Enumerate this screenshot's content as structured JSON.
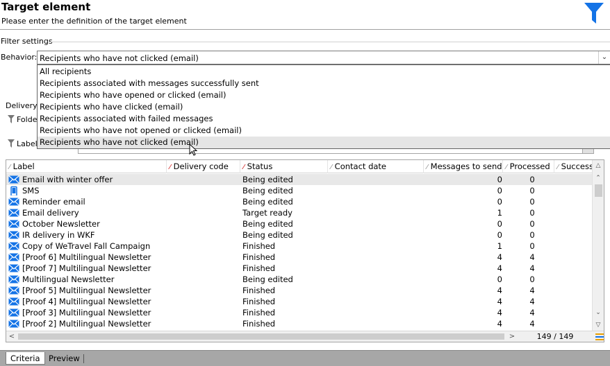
{
  "header": {
    "title": "Target element",
    "subtitle": "Please enter the definition of the target element"
  },
  "filter_settings": {
    "legend": "Filter settings",
    "behavior_label": "Behavior:",
    "behavior_value": "Recipients who have not clicked (email)",
    "options": [
      "All recipients",
      "Recipients associated with messages successfully sent",
      "Recipients who have opened or clicked (email)",
      "Recipients who have clicked (email)",
      "Recipients associated with failed messages",
      "Recipients who have not opened or clicked (email)",
      "Recipients who have not clicked (email)"
    ],
    "hovered_option": "Recipients who have not clicked (email)"
  },
  "delivery": {
    "legend": "Delivery",
    "folder_label": "Folde",
    "label_label": "Label"
  },
  "grid": {
    "columns": [
      "Label",
      "Delivery code",
      "Status",
      "Contact date",
      "Messages to send",
      "Processed",
      "Success"
    ],
    "rows": [
      {
        "label": "Email with winter offer",
        "type": "email",
        "status": "Being edited",
        "messages": "0",
        "processed": "0"
      },
      {
        "label": "SMS",
        "type": "sms",
        "status": "Being edited",
        "messages": "0",
        "processed": "0"
      },
      {
        "label": "Reminder email",
        "type": "email",
        "status": "Being edited",
        "messages": "0",
        "processed": "0"
      },
      {
        "label": "Email delivery",
        "type": "email",
        "status": "Target ready",
        "messages": "1",
        "processed": "0"
      },
      {
        "label": "October Newsletter",
        "type": "email",
        "status": "Being edited",
        "messages": "0",
        "processed": "0"
      },
      {
        "label": "IR delivery in WKF",
        "type": "email",
        "status": "Being edited",
        "messages": "0",
        "processed": "0"
      },
      {
        "label": "Copy of WeTravel Fall Campaign",
        "type": "email",
        "status": "Finished",
        "messages": "1",
        "processed": "0"
      },
      {
        "label": "[Proof 6] Multilingual Newsletter",
        "type": "email",
        "status": "Finished",
        "messages": "4",
        "processed": "4"
      },
      {
        "label": "[Proof 7] Multilingual Newsletter",
        "type": "email",
        "status": "Finished",
        "messages": "4",
        "processed": "4"
      },
      {
        "label": "Multilingual Newsletter",
        "type": "email",
        "status": "Being edited",
        "messages": "0",
        "processed": "0"
      },
      {
        "label": "[Proof 5] Multilingual Newsletter",
        "type": "email",
        "status": "Finished",
        "messages": "4",
        "processed": "4"
      },
      {
        "label": "[Proof 4] Multilingual Newsletter",
        "type": "email",
        "status": "Finished",
        "messages": "4",
        "processed": "4"
      },
      {
        "label": "[Proof 3] Multilingual Newsletter",
        "type": "email",
        "status": "Finished",
        "messages": "4",
        "processed": "4"
      },
      {
        "label": "[Proof 2] Multilingual Newsletter",
        "type": "email",
        "status": "Finished",
        "messages": "4",
        "processed": "4"
      }
    ],
    "count": "149 / 149"
  },
  "tabs": [
    "Criteria",
    "Preview"
  ],
  "colors": {
    "accent": "#1473e6",
    "sort_indicator": "#cc0000",
    "tabbar": "#a7a7a7"
  }
}
